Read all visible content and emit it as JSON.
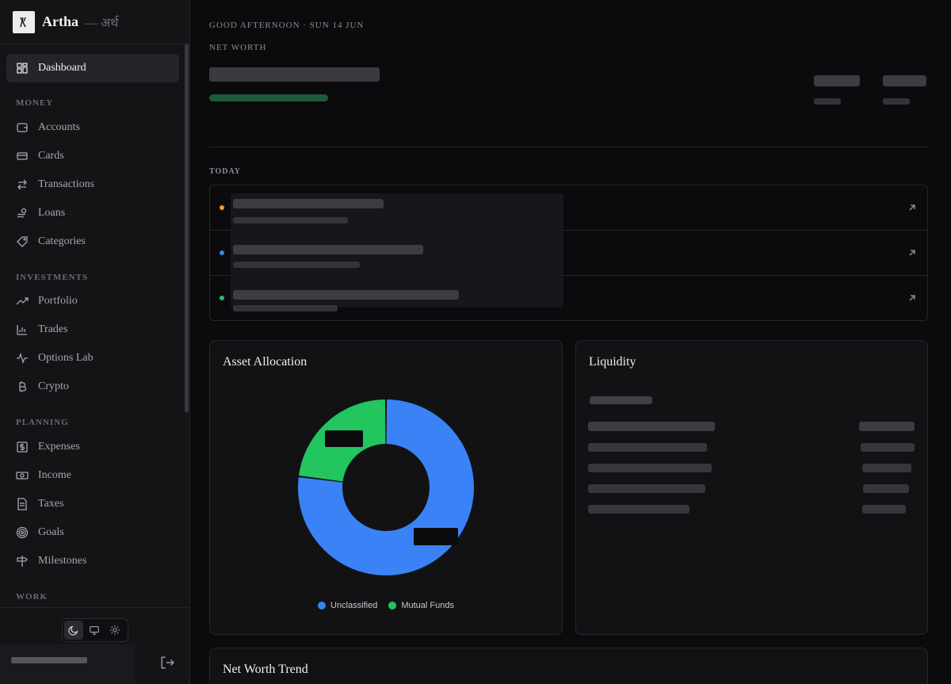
{
  "brand": {
    "name": "Artha",
    "subtitle": "— अर्थ"
  },
  "sidebar": {
    "dashboard": "Dashboard",
    "sections": {
      "money": "MONEY",
      "investments": "INVESTMENTS",
      "planning": "PLANNING",
      "work": "WORK"
    },
    "money_items": [
      "Accounts",
      "Cards",
      "Transactions",
      "Loans",
      "Categories"
    ],
    "investment_items": [
      "Portfolio",
      "Trades",
      "Options Lab",
      "Crypto"
    ],
    "planning_items": [
      "Expenses",
      "Income",
      "Taxes",
      "Goals",
      "Milestones"
    ],
    "theme_selected": "dark"
  },
  "header": {
    "greeting": "GOOD AFTERNOON · SUN 14 JUN",
    "net_worth_label": "NET WORTH"
  },
  "today": {
    "label": "TODAY",
    "dot_colors": [
      "#f59e0b",
      "#3b82f6",
      "#22c55e"
    ]
  },
  "asset_allocation": {
    "title": "Asset Allocation",
    "legend": [
      "Unclassified",
      "Mutual Funds"
    ],
    "colors": [
      "#3b82f6",
      "#22c55e"
    ]
  },
  "liquidity": {
    "title": "Liquidity"
  },
  "net_worth_trend": {
    "title": "Net Worth Trend"
  },
  "chart_data": {
    "type": "pie",
    "categories": [
      "Unclassified",
      "Mutual Funds"
    ],
    "values": [
      77,
      23
    ],
    "colors": [
      "#3b82f6",
      "#22c55e"
    ],
    "legend": "bottom"
  }
}
